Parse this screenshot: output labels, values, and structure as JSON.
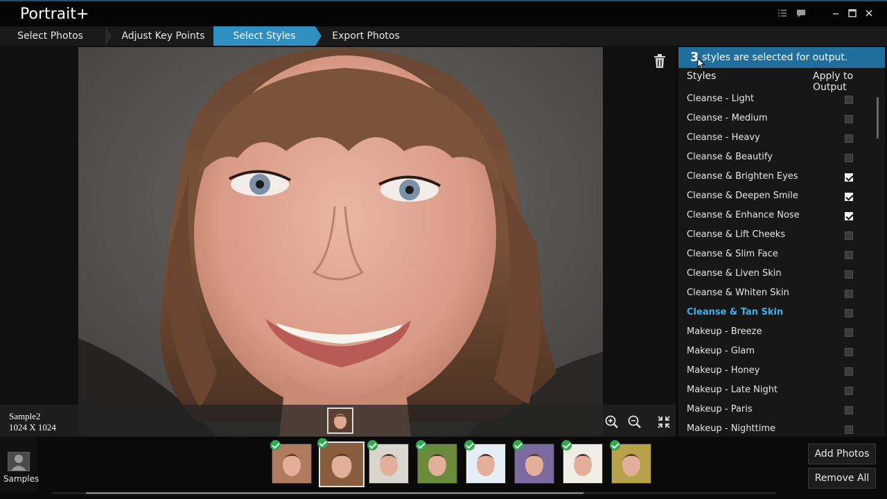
{
  "app": {
    "title": "Portrait+"
  },
  "window_controls": [
    "list-icon",
    "chat-icon",
    "minimize-icon",
    "maximize-icon",
    "close-icon"
  ],
  "steps": [
    {
      "label": "Select Photos",
      "active": false
    },
    {
      "label": "Adjust Key Points",
      "active": false
    },
    {
      "label": "Select Styles",
      "active": true
    },
    {
      "label": "Export Photos",
      "active": false
    }
  ],
  "photo": {
    "name": "Sample2",
    "dimensions": "1024 X 1024"
  },
  "panel": {
    "selected_count": "3",
    "banner_text": "styles are selected for output.",
    "col_styles": "Styles",
    "col_apply": "Apply to Output",
    "styles": [
      {
        "label": "Cleanse - Light",
        "checked": false
      },
      {
        "label": "Cleanse - Medium",
        "checked": false
      },
      {
        "label": "Cleanse - Heavy",
        "checked": false
      },
      {
        "label": "Cleanse & Beautify",
        "checked": false
      },
      {
        "label": "Cleanse & Brighten Eyes",
        "checked": true
      },
      {
        "label": "Cleanse & Deepen Smile",
        "checked": true
      },
      {
        "label": "Cleanse & Enhance Nose",
        "checked": true
      },
      {
        "label": "Cleanse & Lift Cheeks",
        "checked": false
      },
      {
        "label": "Cleanse & Slim Face",
        "checked": false
      },
      {
        "label": "Cleanse & Liven Skin",
        "checked": false
      },
      {
        "label": "Cleanse & Whiten Skin",
        "checked": false
      },
      {
        "label": "Cleanse & Tan Skin",
        "checked": false,
        "highlight": true
      },
      {
        "label": "Makeup - Breeze",
        "checked": false
      },
      {
        "label": "Makeup - Glam",
        "checked": false
      },
      {
        "label": "Makeup - Honey",
        "checked": false
      },
      {
        "label": "Makeup - Late Night",
        "checked": false
      },
      {
        "label": "Makeup - Paris",
        "checked": false
      },
      {
        "label": "Makeup - Nighttime",
        "checked": false
      }
    ]
  },
  "filmstrip": {
    "samples_label": "Samples",
    "thumbs": [
      {
        "bg": "#b07a5e",
        "checked": true,
        "selected": false
      },
      {
        "bg": "#8a5c3e",
        "checked": true,
        "selected": true
      },
      {
        "bg": "#d9d6cf",
        "checked": true,
        "selected": false
      },
      {
        "bg": "#6b8a3a",
        "checked": true,
        "selected": false
      },
      {
        "bg": "#e6eef5",
        "checked": true,
        "selected": false
      },
      {
        "bg": "#7a6aa0",
        "checked": true,
        "selected": false
      },
      {
        "bg": "#f0ece6",
        "checked": true,
        "selected": false
      },
      {
        "bg": "#b7a24a",
        "checked": true,
        "selected": false
      }
    ],
    "add_label": "Add Photos",
    "remove_label": "Remove All"
  },
  "colors": {
    "accent": "#2e8fc0",
    "banner": "#1f6e9e",
    "highlight": "#3fb0ea",
    "check": "#2fa84f"
  }
}
